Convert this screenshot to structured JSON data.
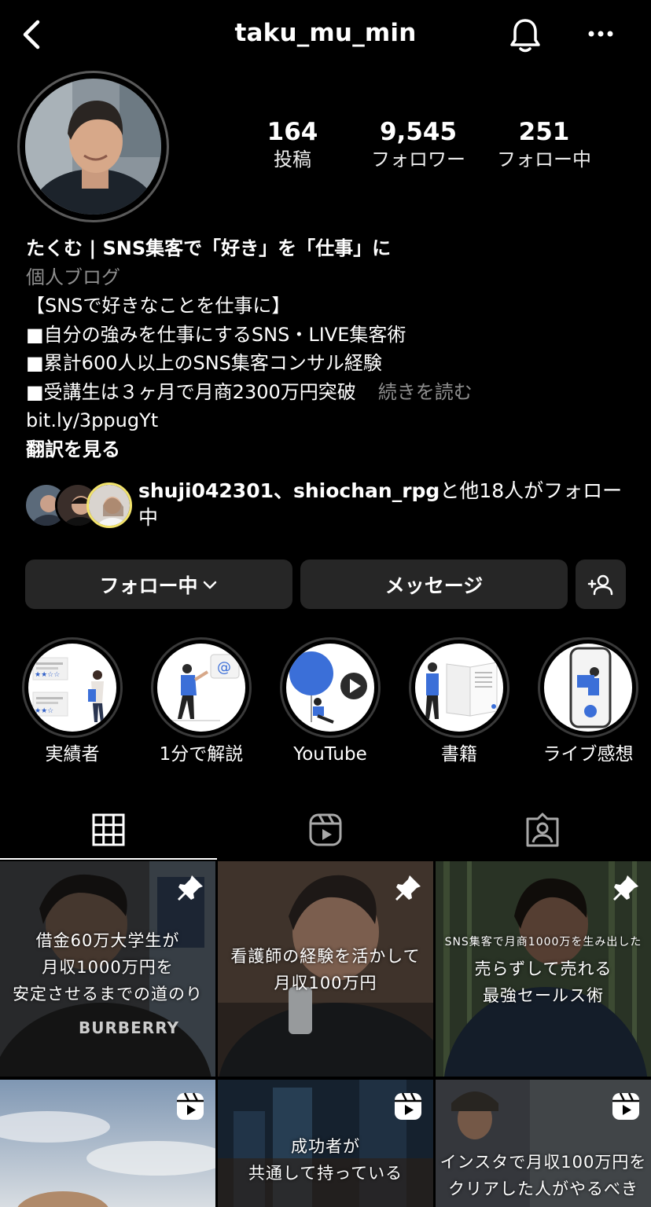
{
  "header": {
    "username": "taku_mu_min",
    "back_icon": "chevron-left-icon",
    "bell_icon": "bell-icon",
    "more_icon": "more-horizontal-icon"
  },
  "stats": [
    {
      "value": "164",
      "label": "投稿"
    },
    {
      "value": "9,545",
      "label": "フォロワー"
    },
    {
      "value": "251",
      "label": "フォロー中"
    }
  ],
  "bio": {
    "name": "たくむ | SNS集客で「好き」を「仕事」に",
    "category": "個人ブログ",
    "lines": [
      "【SNSで好きなことを仕事に】",
      "■自分の強みを仕事にするSNS・LIVE集客術",
      "■累計600人以上のSNS集客コンサル経験",
      "■受講生は３ヶ月で月商2300万円突破"
    ],
    "more": "続きを読む",
    "link": "bit.ly/3ppugYt",
    "translate": "翻訳を見る"
  },
  "followed_by": {
    "names": "shuji042301、shiochan_rpg",
    "suffix": "と他18人がフォロー中"
  },
  "buttons": {
    "following": "フォロー中",
    "message": "メッセージ"
  },
  "highlights": [
    {
      "label": "実績者"
    },
    {
      "label": "1分で解説"
    },
    {
      "label": "YouTube"
    },
    {
      "label": "書籍"
    },
    {
      "label": "ライブ感想"
    }
  ],
  "tabs": [
    "grid-icon",
    "reels-icon",
    "tagged-icon"
  ],
  "posts": [
    {
      "caption": [
        "借金60万大学生が",
        "月収1000万円を",
        "安定させるまでの道のり"
      ],
      "badge": "pin-icon",
      "overlay": "BURBERRY"
    },
    {
      "caption": [
        "看護師の経験を活かして",
        "月収100万円"
      ],
      "badge": "pin-icon"
    },
    {
      "caption": [
        "SNS集客で月商1000万を生み出した",
        "売らずして売れる",
        "最強セールス術"
      ],
      "badge": "pin-icon"
    },
    {
      "caption": [],
      "badge": "reel-icon"
    },
    {
      "caption": [
        "成功者が",
        "共通して持っている"
      ],
      "badge": "reel-icon"
    },
    {
      "caption": [
        "インスタで月収100万円を",
        "クリアした人がやるべき"
      ],
      "badge": "reel-icon"
    }
  ],
  "colors": {
    "background": "#000000",
    "button": "#262626",
    "muted": "#8e8e8e"
  }
}
